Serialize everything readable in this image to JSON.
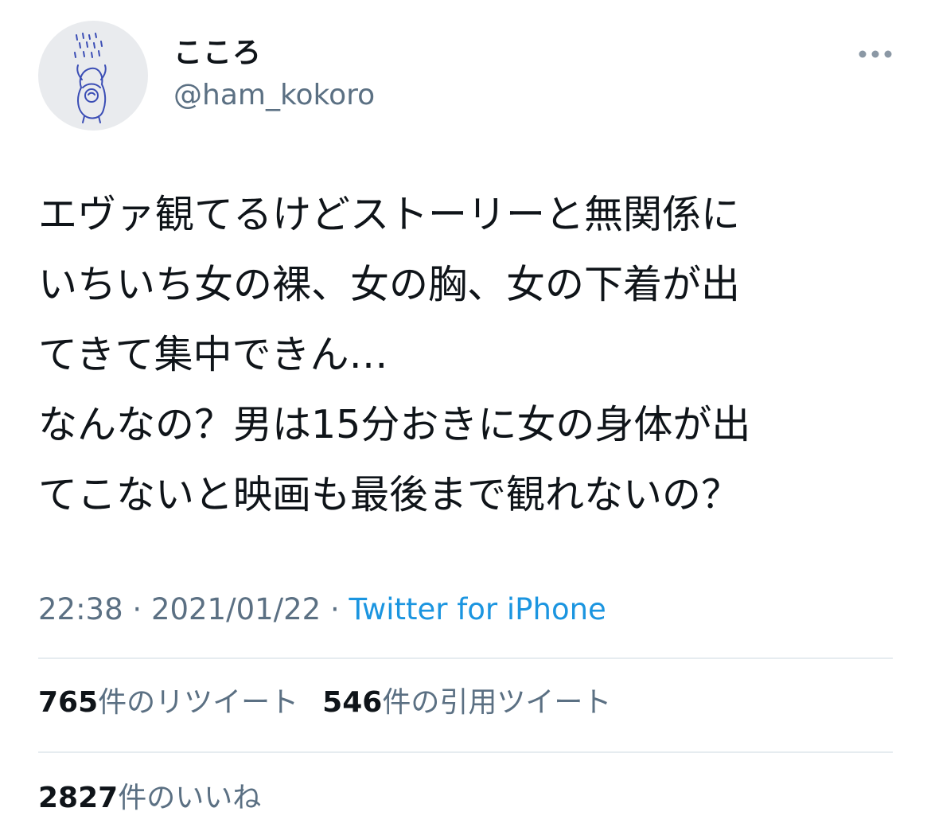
{
  "user": {
    "display_name": "こころ",
    "handle": "@ham_kokoro",
    "avatar_icon": "avatar-drawing-icon"
  },
  "tweet": {
    "lines": [
      "エヴァ観てるけどストーリーと無関係に",
      "いちいち女の裸、女の胸、女の下着が出",
      "てきて集中できん…",
      "なんなの？男は15分おきに女の身体が出",
      "てこないと映画も最後まで観れないの？"
    ]
  },
  "meta": {
    "time": "22:38",
    "separator": " · ",
    "date": "2021/01/22",
    "source": "Twitter for iPhone"
  },
  "stats": {
    "retweets_count": "765",
    "retweets_label": "件のリツイート",
    "quotes_count": "546",
    "quotes_label": "件の引用ツイート",
    "likes_count": "2827",
    "likes_label": "件のいいね"
  },
  "colors": {
    "text": "#0f1419",
    "secondary": "#5b7083",
    "link": "#1b95e0",
    "divider": "#e6ecf0"
  }
}
